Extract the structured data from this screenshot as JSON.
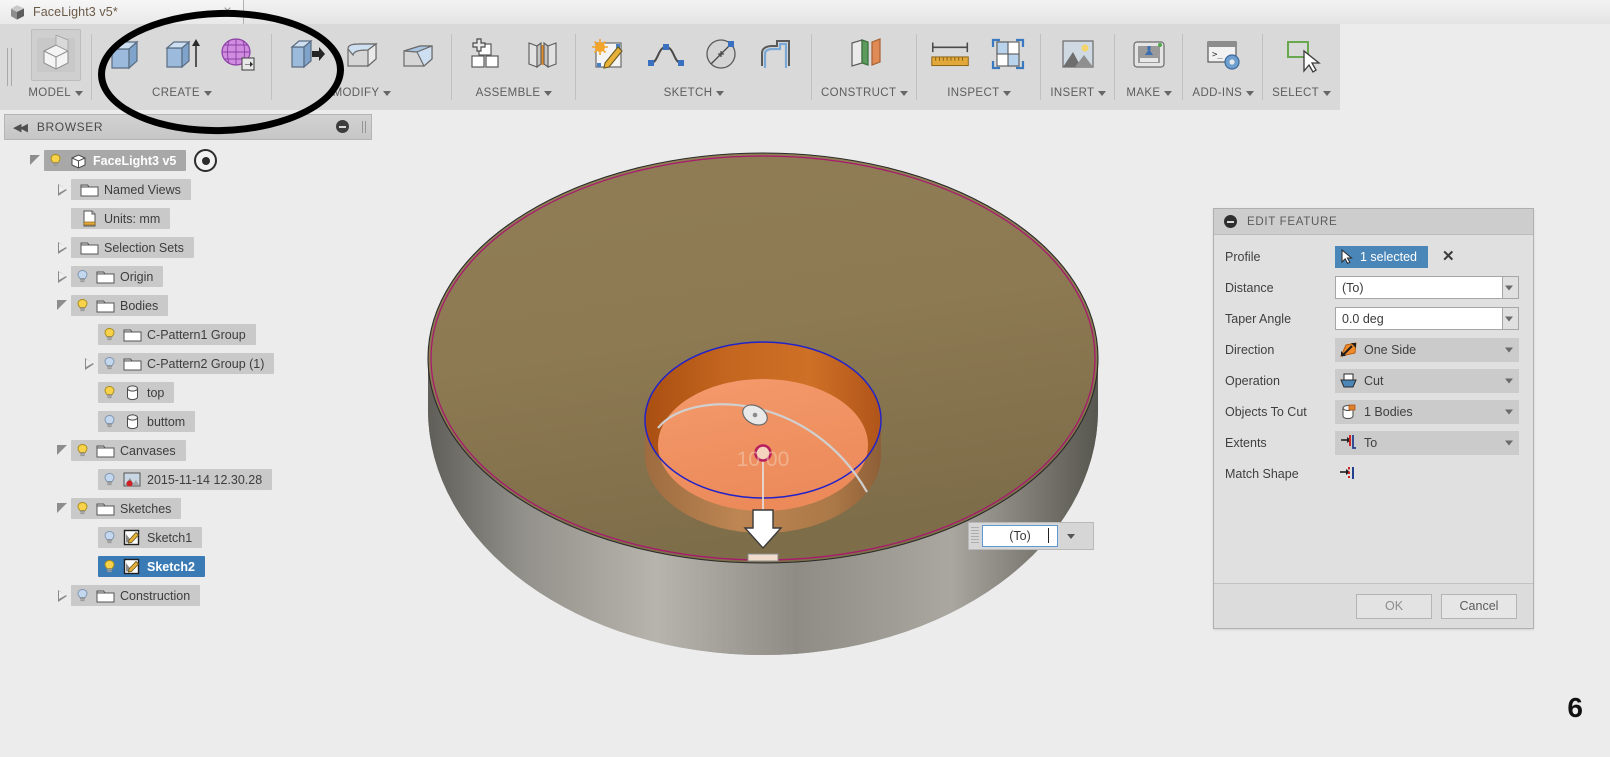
{
  "titlebar": {
    "document_tab": "FaceLight3 v5*",
    "close_label": "×",
    "cube_icon": "document-cube-icon"
  },
  "ribbon": {
    "groups": [
      {
        "name": "model",
        "label": "MODEL",
        "icons": [
          "workspace-cube-icon"
        ]
      },
      {
        "name": "create",
        "label": "CREATE",
        "icons": [
          "box-icon",
          "extrude-icon",
          "sculpt-mesh-icon"
        ]
      },
      {
        "name": "modify",
        "label": "MODIFY",
        "icons": [
          "press-pull-icon",
          "fillet-icon",
          "chamfer-icon"
        ]
      },
      {
        "name": "assemble",
        "label": "ASSEMBLE",
        "icons": [
          "new-component-icon",
          "joint-icon"
        ]
      },
      {
        "name": "sketch",
        "label": "SKETCH",
        "icons": [
          "create-sketch-icon",
          "spline-icon",
          "circle-icon",
          "offset-icon"
        ]
      },
      {
        "name": "construct",
        "label": "CONSTRUCT",
        "icons": [
          "offset-plane-icon"
        ]
      },
      {
        "name": "inspect",
        "label": "INSPECT",
        "icons": [
          "measure-icon",
          "section-analysis-icon"
        ]
      },
      {
        "name": "insert",
        "label": "INSERT",
        "icons": [
          "insert-canvas-icon"
        ]
      },
      {
        "name": "make",
        "label": "MAKE",
        "icons": [
          "3d-print-icon"
        ]
      },
      {
        "name": "addins",
        "label": "ADD-INS",
        "icons": [
          "scripts-addins-icon"
        ]
      },
      {
        "name": "select",
        "label": "SELECT",
        "icons": [
          "select-cursor-icon"
        ]
      }
    ]
  },
  "annotation": {
    "name": "hand-drawn-ellipse-highlight",
    "target": "CREATE group"
  },
  "browser": {
    "panel_title": "BROWSER",
    "collapse_icon": "double-left-arrow-icon",
    "minimize_icon": "minimize-icon",
    "tree": [
      {
        "label": "FaceLight3 v5",
        "indent": 0,
        "twist": "open",
        "bulb": "on",
        "icon": "component-cube-icon",
        "state": "root",
        "has_radio": true
      },
      {
        "label": "Named Views",
        "indent": 1,
        "twist": "closed",
        "bulb": "none",
        "icon": "folder-icon",
        "state": "normal",
        "has_radio": false
      },
      {
        "label": "Units: mm",
        "indent": 1,
        "twist": "none",
        "bulb": "none",
        "icon": "units-doc-icon",
        "state": "normal",
        "has_radio": false
      },
      {
        "label": "Selection Sets",
        "indent": 1,
        "twist": "closed",
        "bulb": "none",
        "icon": "folder-icon",
        "state": "normal",
        "has_radio": false
      },
      {
        "label": "Origin",
        "indent": 1,
        "twist": "closed",
        "bulb": "off",
        "icon": "folder-icon",
        "state": "normal",
        "has_radio": false
      },
      {
        "label": "Bodies",
        "indent": 1,
        "twist": "open",
        "bulb": "on",
        "icon": "folder-icon",
        "state": "normal",
        "has_radio": false
      },
      {
        "label": "C-Pattern1 Group",
        "indent": 2,
        "twist": "none",
        "bulb": "on",
        "icon": "folder-icon",
        "state": "normal",
        "has_radio": false
      },
      {
        "label": "C-Pattern2 Group (1)",
        "indent": 2,
        "twist": "closed",
        "bulb": "off",
        "icon": "folder-icon",
        "state": "normal",
        "has_radio": false
      },
      {
        "label": "top",
        "indent": 2,
        "twist": "none",
        "bulb": "on",
        "icon": "body-cylinder-icon",
        "state": "normal",
        "has_radio": false
      },
      {
        "label": "buttom",
        "indent": 2,
        "twist": "none",
        "bulb": "off",
        "icon": "body-cylinder-icon",
        "state": "normal",
        "has_radio": false
      },
      {
        "label": "Canvases",
        "indent": 1,
        "twist": "open",
        "bulb": "on",
        "icon": "folder-icon",
        "state": "normal",
        "has_radio": false
      },
      {
        "label": "2015-11-14 12.30.28",
        "indent": 2,
        "twist": "none",
        "bulb": "off",
        "icon": "canvas-image-icon",
        "state": "normal",
        "has_radio": false
      },
      {
        "label": "Sketches",
        "indent": 1,
        "twist": "open",
        "bulb": "on",
        "icon": "folder-icon",
        "state": "normal",
        "has_radio": false
      },
      {
        "label": "Sketch1",
        "indent": 2,
        "twist": "none",
        "bulb": "off",
        "icon": "sketch-icon",
        "state": "normal",
        "has_radio": false
      },
      {
        "label": "Sketch2",
        "indent": 2,
        "twist": "none",
        "bulb": "on",
        "icon": "sketch-icon",
        "state": "selected",
        "has_radio": false
      },
      {
        "label": "Construction",
        "indent": 1,
        "twist": "closed",
        "bulb": "off",
        "icon": "folder-icon",
        "state": "normal",
        "has_radio": false
      }
    ]
  },
  "canvas": {
    "page_number": "6",
    "manipulator_value": "10.00",
    "dimension_field": {
      "value": "(To)",
      "dropdown_icon": "chevron-down-icon",
      "grip_icon": "drag-grip-icon"
    },
    "model": {
      "base_top_color": "#8e7b52",
      "base_side_color": "#8a8880",
      "pocket_wall_color": "#c4651f",
      "pocket_floor_color": "#f29263",
      "bore_side_color": "#b9824f",
      "sketch_edge_color": "#2323c8",
      "profile_edge_color": "#a81a6e"
    }
  },
  "dialog": {
    "title": "EDIT FEATURE",
    "minimize_icon": "minimize-icon",
    "rows": [
      {
        "label": "Profile",
        "kind": "selection",
        "value": "1 selected",
        "icon": "cursor-select-icon",
        "clear_icon": "clear-selection-icon"
      },
      {
        "label": "Distance",
        "kind": "text",
        "value": "(To)",
        "icon": "",
        "dropdown": true
      },
      {
        "label": "Taper Angle",
        "kind": "text",
        "value": "0.0 deg",
        "icon": "",
        "dropdown": true
      },
      {
        "label": "Direction",
        "kind": "combo",
        "value": "One Side",
        "icon": "one-side-arrow-icon",
        "dropdown": true
      },
      {
        "label": "Operation",
        "kind": "combo",
        "value": "Cut",
        "icon": "cut-operation-icon",
        "dropdown": true
      },
      {
        "label": "Objects To Cut",
        "kind": "combo",
        "value": "1 Bodies",
        "icon": "bodies-icon",
        "dropdown": true
      },
      {
        "label": "Extents",
        "kind": "combo",
        "value": "To",
        "icon": "extent-to-icon",
        "dropdown": true
      },
      {
        "label": "Match Shape",
        "kind": "plain",
        "value": "",
        "icon": "match-shape-icon",
        "dropdown": false
      }
    ],
    "ok_label": "OK",
    "cancel_label": "Cancel"
  }
}
